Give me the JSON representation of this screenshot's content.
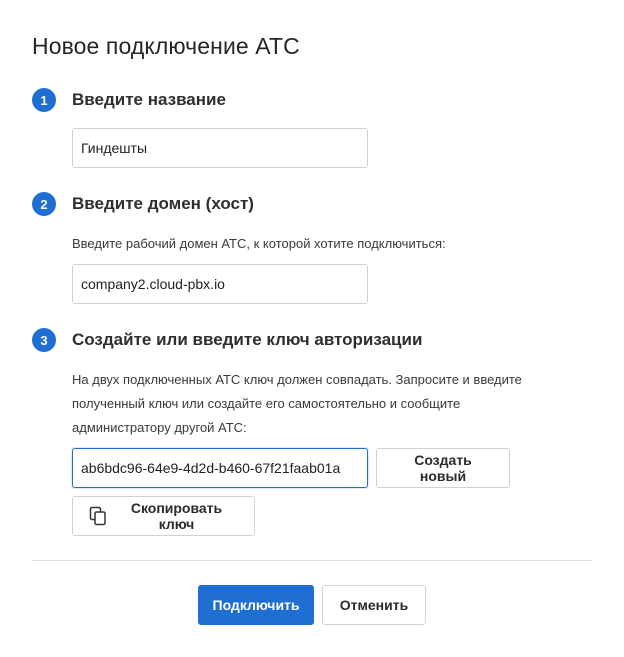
{
  "dialog": {
    "title": "Новое подключение АТС"
  },
  "steps": [
    {
      "number": "1",
      "title": "Введите название",
      "input_value": "Гиндешты"
    },
    {
      "number": "2",
      "title": "Введите домен (хост)",
      "hint": "Введите рабочий домен АТС, к которой хотите подключиться:",
      "input_value": "company2.cloud-pbx.io"
    },
    {
      "number": "3",
      "title": "Создайте или введите ключ авторизации",
      "hint_lines": [
        "На двух подключенных АТС ключ должен совпадать. Запросите и введите",
        "полученный ключ или создайте его самостоятельно и сообщите",
        "администратору другой АТС:"
      ],
      "input_value": "ab6bdc96-64e9-4d2d-b460-67f21faab01a",
      "create_button": "Создать новый",
      "copy_button": "Скопировать ключ",
      "copy_icon": "copy-icon"
    }
  ],
  "footer": {
    "connect_button": "Подключить",
    "cancel_button": "Отменить"
  },
  "colors": {
    "accent": "#1f6fd2",
    "border": "#cfd3d8",
    "divider": "#dcdfe3"
  }
}
